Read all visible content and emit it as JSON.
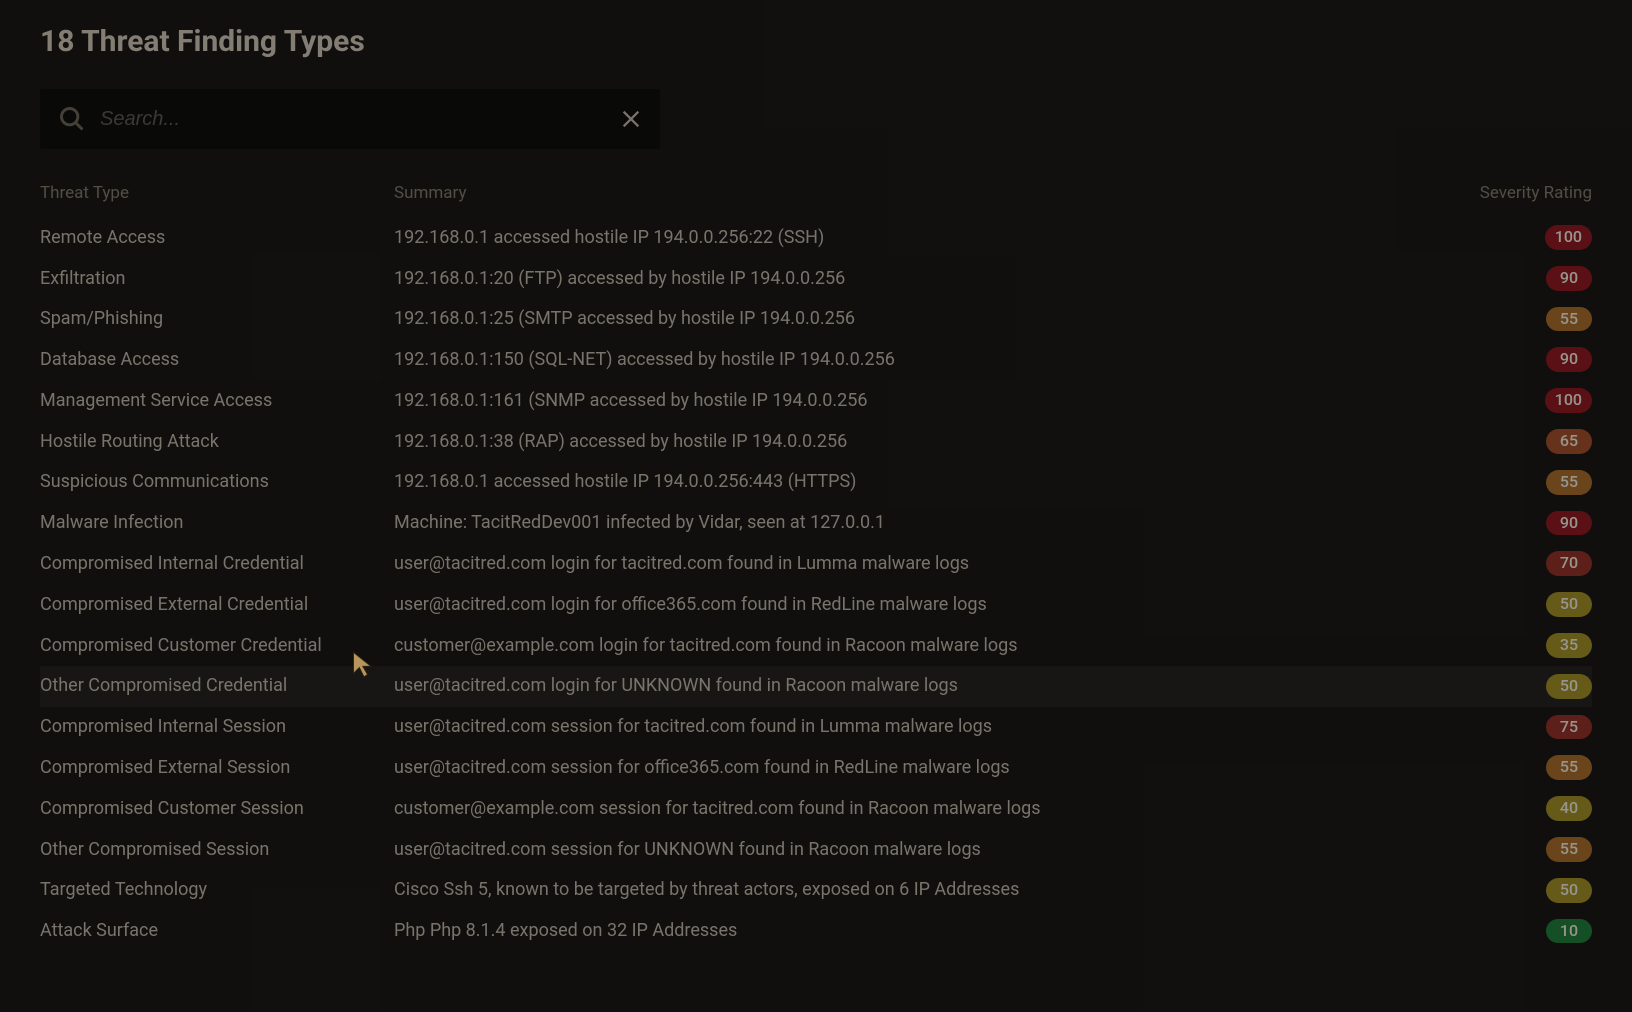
{
  "title": "18 Threat Finding Types",
  "search": {
    "placeholder": "Search..."
  },
  "columns": {
    "type": "Threat Type",
    "summary": "Summary",
    "severity": "Severity Rating"
  },
  "rows": [
    {
      "type": "Remote Access",
      "summary": "192.168.0.1 accessed hostile IP 194.0.0.256:22 (SSH)",
      "severity": 100,
      "sev_class": "sev-critical"
    },
    {
      "type": "Exfiltration",
      "summary": "192.168.0.1:20 (FTP) accessed by hostile IP 194.0.0.256",
      "severity": 90,
      "sev_class": "sev-critical"
    },
    {
      "type": "Spam/Phishing",
      "summary": "192.168.0.1:25 (SMTP accessed by hostile IP 194.0.0.256",
      "severity": 55,
      "sev_class": "sev-medium"
    },
    {
      "type": "Database Access",
      "summary": "192.168.0.1:150 (SQL-NET) accessed by hostile IP 194.0.0.256",
      "severity": 90,
      "sev_class": "sev-critical"
    },
    {
      "type": "Management Service Access",
      "summary": "192.168.0.1:161 (SNMP accessed by hostile IP 194.0.0.256",
      "severity": 100,
      "sev_class": "sev-critical"
    },
    {
      "type": "Hostile Routing Attack",
      "summary": "192.168.0.1:38 (RAP) accessed by hostile IP 194.0.0.256",
      "severity": 65,
      "sev_class": "sev-med-high"
    },
    {
      "type": "Suspicious Communications",
      "summary": "192.168.0.1 accessed hostile IP 194.0.0.256:443 (HTTPS)",
      "severity": 55,
      "sev_class": "sev-medium"
    },
    {
      "type": "Malware Infection",
      "summary": "Machine: TacitRedDev001 infected by Vidar, seen at 127.0.0.1",
      "severity": 90,
      "sev_class": "sev-critical"
    },
    {
      "type": "Compromised Internal Credential",
      "summary": "user@tacitred.com login for tacitred.com found in Lumma malware logs",
      "severity": 70,
      "sev_class": "sev-high"
    },
    {
      "type": "Compromised External Credential",
      "summary": "user@tacitred.com login for office365.com found in RedLine malware logs",
      "severity": 50,
      "sev_class": "sev-low"
    },
    {
      "type": "Compromised Customer Credential",
      "summary": "customer@example.com login for tacitred.com found in Racoon malware logs",
      "severity": 35,
      "sev_class": "sev-low"
    },
    {
      "type": "Other Compromised Credential",
      "summary": "user@tacitred.com login for UNKNOWN found in Racoon malware logs",
      "severity": 50,
      "sev_class": "sev-low",
      "hovered": true
    },
    {
      "type": "Compromised Internal Session",
      "summary": "user@tacitred.com session for tacitred.com found in Lumma malware logs",
      "severity": 75,
      "sev_class": "sev-high"
    },
    {
      "type": "Compromised External Session",
      "summary": "user@tacitred.com session for office365.com found in RedLine malware logs",
      "severity": 55,
      "sev_class": "sev-medium"
    },
    {
      "type": "Compromised Customer Session",
      "summary": "customer@example.com session for tacitred.com found in Racoon malware logs",
      "severity": 40,
      "sev_class": "sev-low"
    },
    {
      "type": "Other Compromised Session",
      "summary": "user@tacitred.com session for UNKNOWN found in Racoon malware logs",
      "severity": 55,
      "sev_class": "sev-medium"
    },
    {
      "type": "Targeted Technology",
      "summary": "Cisco Ssh 5, known to be targeted by threat actors, exposed on 6 IP Addresses",
      "severity": 50,
      "sev_class": "sev-low"
    },
    {
      "type": "Attack Surface",
      "summary": "Php Php 8.1.4 exposed on 32 IP Addresses",
      "severity": 10,
      "sev_class": "sev-very-low"
    }
  ]
}
